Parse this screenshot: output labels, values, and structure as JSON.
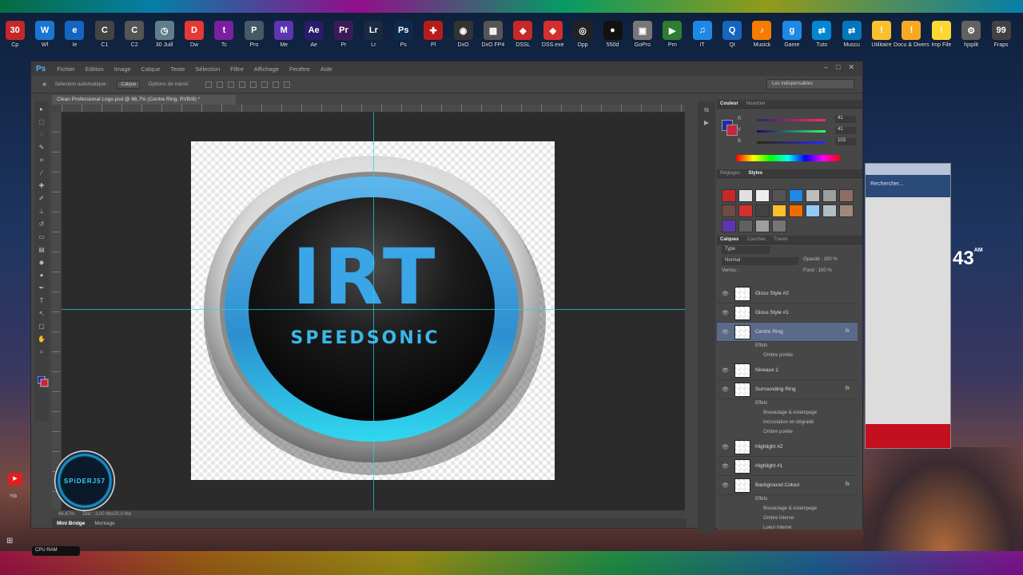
{
  "desktop": {
    "icons": [
      {
        "label": "Cp",
        "glyph": "30",
        "color": "#c62828"
      },
      {
        "label": "Wf",
        "glyph": "W",
        "color": "#1976d2"
      },
      {
        "label": "Ie",
        "glyph": "e",
        "color": "#1565c0"
      },
      {
        "label": "C1",
        "glyph": "C",
        "color": "#444"
      },
      {
        "label": "C2",
        "glyph": "C",
        "color": "#555"
      },
      {
        "label": "30 Juill",
        "glyph": "◷",
        "color": "#607d8b"
      },
      {
        "label": "Dw",
        "glyph": "D",
        "color": "#e53935"
      },
      {
        "label": "Tc",
        "glyph": "t",
        "color": "#7b1fa2"
      },
      {
        "label": "Pro",
        "glyph": "P",
        "color": "#455a64"
      },
      {
        "label": "Me",
        "glyph": "M",
        "color": "#5e35b1"
      },
      {
        "label": "Ae",
        "glyph": "Ae",
        "color": "#2a1a6a"
      },
      {
        "label": "Pr",
        "glyph": "Pr",
        "color": "#3b1a5a"
      },
      {
        "label": "Lr",
        "glyph": "Lr",
        "color": "#1a2a40"
      },
      {
        "label": "Ps",
        "glyph": "Ps",
        "color": "#0c2a4a"
      },
      {
        "label": "Pl",
        "glyph": "✚",
        "color": "#b71c1c"
      },
      {
        "label": "DxO",
        "glyph": "◉",
        "color": "#333"
      },
      {
        "label": "DxO FP4",
        "glyph": "▦",
        "color": "#555"
      },
      {
        "label": "DSSL",
        "glyph": "◆",
        "color": "#c62828"
      },
      {
        "label": "DSS.exe",
        "glyph": "◆",
        "color": "#d32f2f"
      },
      {
        "label": "Dpp",
        "glyph": "◎",
        "color": "#222"
      },
      {
        "label": "550d",
        "glyph": "●",
        "color": "#111"
      },
      {
        "label": "GoPro",
        "glyph": "▣",
        "color": "#777"
      },
      {
        "label": "Prn",
        "glyph": "▶",
        "color": "#2e7d32"
      },
      {
        "label": "iT",
        "glyph": "♫",
        "color": "#1e88e5"
      },
      {
        "label": "Qt",
        "glyph": "Q",
        "color": "#1565c0"
      },
      {
        "label": "Musick",
        "glyph": "♪",
        "color": "#f57c00"
      },
      {
        "label": "Game",
        "glyph": "g",
        "color": "#1e88e5"
      },
      {
        "label": "Tuto",
        "glyph": "⇄",
        "color": "#0288d1"
      },
      {
        "label": "Muscu",
        "glyph": "⇄",
        "color": "#0277bd"
      },
      {
        "label": "Utilitaire",
        "glyph": "!",
        "color": "#fbc02d"
      },
      {
        "label": "Docu & Divers",
        "glyph": "!",
        "color": "#f9a825"
      },
      {
        "label": "Imp File",
        "glyph": "!",
        "color": "#fdd835"
      },
      {
        "label": "hjsplit",
        "glyph": "⚙",
        "color": "#616161"
      },
      {
        "label": "Fraps",
        "glyph": "99",
        "color": "#424242"
      }
    ]
  },
  "photoshop": {
    "app_logo": "Ps",
    "menu": [
      "Fichier",
      "Edition",
      "Image",
      "Calque",
      "Texte",
      "Sélection",
      "Filtre",
      "Affichage",
      "Fenêtre",
      "Aide"
    ],
    "options": {
      "auto_select": "Sélection automatique :",
      "auto_select_value": "Calque",
      "transform": "Options de transf.",
      "workspace": "Les indispensables"
    },
    "document": {
      "tab": "Clean Professional Logo.psd @ 66,7% (Centre Ring, RVB/8) *",
      "logo_main": "IRT",
      "logo_sub": "SPEEDSONiC",
      "status": "Doc : 3,00 Mo/20,0 Mo",
      "zoom": "66,67%"
    },
    "bottom_tabs": [
      "Mini Bridge",
      "Montage"
    ],
    "color_panel": {
      "tabs": [
        "Couleur",
        "Nuancier"
      ],
      "channels": [
        {
          "name": "R",
          "value": "41"
        },
        {
          "name": "V",
          "value": "41"
        },
        {
          "name": "B",
          "value": "103"
        }
      ]
    },
    "styles_panel": {
      "tabs": [
        "Réglages",
        "Styles"
      ],
      "swatches": [
        "#c62828",
        "#e0e0e0",
        "#eeeeee",
        "#555555",
        "#1e88e5",
        "#bdbdbd",
        "#9e9e9e",
        "#8d6e63",
        "#6d4c41",
        "#d32f2f",
        "#424242",
        "#fbc02d",
        "#ef6c00",
        "#90caf9",
        "#b0bec5",
        "#a1887f",
        "#5e35b1",
        "#616161",
        "#9e9e9e",
        "#757575"
      ]
    },
    "layers_panel": {
      "tabs": [
        "Calques",
        "Couches",
        "Tracés"
      ],
      "filter": "Type",
      "blend_mode": "Normal",
      "opacity_label": "Opacité :",
      "opacity": "100 %",
      "lock_label": "Verrou :",
      "fill_label": "Fond :",
      "fill": "100 %",
      "layers": [
        {
          "name": "Gloss Style #2",
          "fx": "",
          "effects": []
        },
        {
          "name": "Gloss Style #1",
          "fx": "",
          "effects": []
        },
        {
          "name": "Centre Ring",
          "fx": "fx",
          "selected": true,
          "effects_label": "Effets",
          "effects": [
            "Ombre portée"
          ]
        },
        {
          "name": "Niveaux 1",
          "fx": "",
          "effects": []
        },
        {
          "name": "Surrounding Ring",
          "fx": "fx",
          "effects_label": "Effets",
          "effects": [
            "Biseautage & estampage",
            "Incrustation en dégradé",
            "Ombre portée"
          ]
        },
        {
          "name": "Highlight #2",
          "fx": "",
          "effects": []
        },
        {
          "name": "Highlight #1",
          "fx": "",
          "effects": []
        },
        {
          "name": "Background Colour",
          "fx": "fx",
          "effects_label": "Effets",
          "effects": [
            "Biseautage & estampage",
            "Ombre interne",
            "Lueur interne"
          ]
        }
      ]
    }
  },
  "overlays": {
    "watermark": "SPiDERJ57",
    "youtube_label": "Ytb",
    "cpu_ram": "CPU RAM",
    "clock_digits": "43",
    "clock_ampm": "AM",
    "browser_search": "Rechercher..."
  }
}
